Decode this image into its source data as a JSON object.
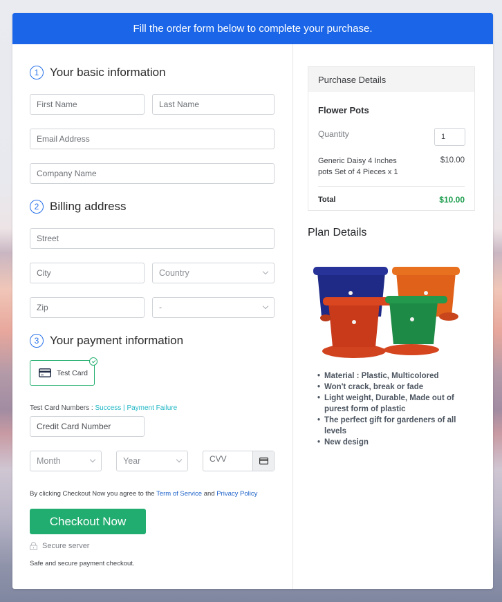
{
  "banner": {
    "text": "Fill the order form below to complete your purchase."
  },
  "sections": {
    "basic": {
      "number": "1",
      "title": "Your basic information"
    },
    "billing": {
      "number": "2",
      "title": "Billing address"
    },
    "payment": {
      "number": "3",
      "title": "Your payment information"
    }
  },
  "fields": {
    "first_name": "First Name",
    "last_name": "Last Name",
    "email": "Email Address",
    "company": "Company Name",
    "street": "Street",
    "city": "City",
    "country": "Country",
    "zip": "Zip",
    "state": "-",
    "card_number": "Credit Card Number",
    "month": "Month",
    "year": "Year",
    "cvv": "CVV"
  },
  "payment": {
    "method_label": "Test Card",
    "test_numbers_label": "Test Card Numbers : ",
    "success_link": "Success",
    "separator": " | ",
    "failure_link": "Payment Failure"
  },
  "terms": {
    "prefix": "By clicking Checkout Now you agree to the ",
    "tos_link": "Term of Service",
    "middle": " and ",
    "privacy_link": "Privacy Policy"
  },
  "checkout": {
    "button_label": "Checkout Now",
    "secure_label": "Secure server",
    "safe_text": "Safe and secure payment checkout."
  },
  "purchase": {
    "header": "Purchase Details",
    "product_name": "Flower Pots",
    "quantity_label": "Quantity",
    "quantity_value": "1",
    "item_desc_line1": "Generic Daisy 4 Inches",
    "item_desc_line2": "pots Set of 4 Pieces x 1",
    "item_price": "$10.00",
    "total_label": "Total",
    "total_value": "$10.00"
  },
  "plan": {
    "title": "Plan Details",
    "features": [
      "Material : Plastic, Multicolored",
      "Won't crack, break or fade",
      "Light weight, Durable, Made out of purest form of plastic",
      "The perfect gift for gardeners of all levels",
      "New design"
    ]
  },
  "colors": {
    "banner": "#1b66e8",
    "accent_green": "#22ad70",
    "total_green": "#1f9e4f"
  }
}
